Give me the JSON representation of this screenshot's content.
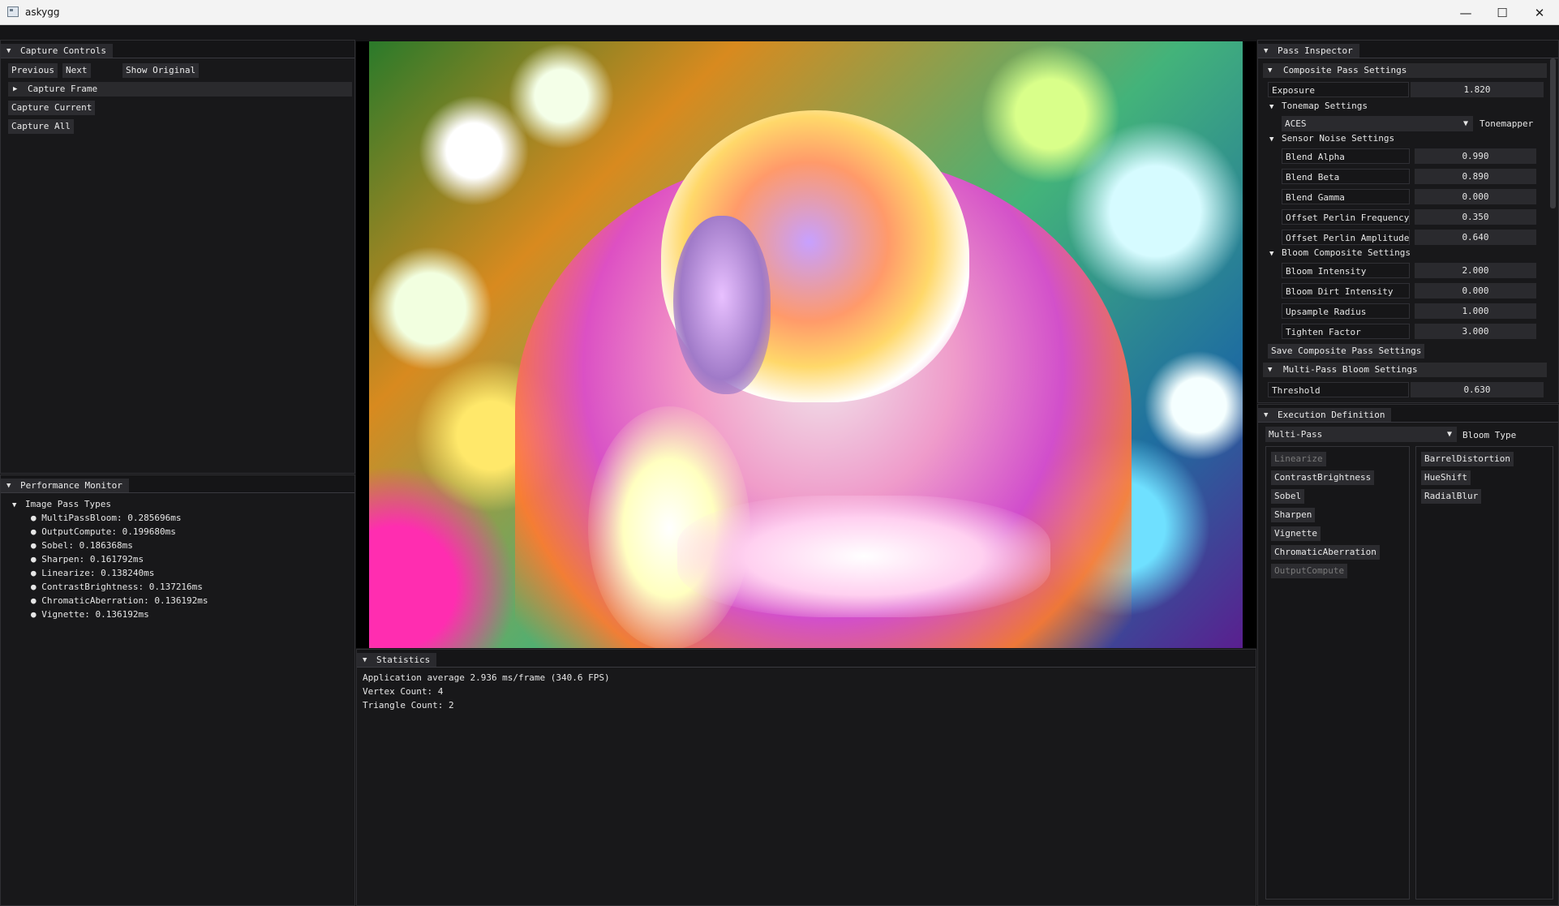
{
  "window": {
    "title": "askygg",
    "minimize": "—",
    "maximize": "☐",
    "close": "✕"
  },
  "capture_controls": {
    "title": "Capture Controls",
    "previous": "Previous",
    "next": "Next",
    "show_original": "Show Original",
    "capture_frame": "Capture Frame",
    "capture_current": "Capture Current",
    "capture_all": "Capture All"
  },
  "performance_monitor": {
    "title": "Performance Monitor",
    "group": "Image Pass Types",
    "items": [
      "MultiPassBloom: 0.285696ms",
      "OutputCompute: 0.199680ms",
      "Sobel: 0.186368ms",
      "Sharpen: 0.161792ms",
      "Linearize: 0.138240ms",
      "ContrastBrightness: 0.137216ms",
      "ChromaticAberration: 0.136192ms",
      "Vignette: 0.136192ms"
    ]
  },
  "statistics": {
    "title": "Statistics",
    "lines": [
      "Application average 2.936 ms/frame (340.6 FPS)",
      "Vertex Count: 4",
      "Triangle Count: 2"
    ]
  },
  "pass_inspector": {
    "title": "Pass Inspector",
    "composite_header": "Composite Pass Settings",
    "exposure_label": "Exposure",
    "exposure_value": "1.820",
    "tonemap_header": "Tonemap Settings",
    "tonemapper_value": "ACES",
    "tonemapper_label": "Tonemapper",
    "sensor_header": "Sensor Noise Settings",
    "sensor_fields": [
      {
        "label": "Blend Alpha",
        "value": "0.990"
      },
      {
        "label": "Blend Beta",
        "value": "0.890"
      },
      {
        "label": "Blend Gamma",
        "value": "0.000"
      },
      {
        "label": "Offset Perlin Frequency",
        "value": "0.350"
      },
      {
        "label": "Offset Perlin Amplitude",
        "value": "0.640"
      }
    ],
    "bloom_header": "Bloom Composite Settings",
    "bloom_fields": [
      {
        "label": "Bloom Intensity",
        "value": "2.000"
      },
      {
        "label": "Bloom Dirt Intensity",
        "value": "0.000"
      },
      {
        "label": "Upsample Radius",
        "value": "1.000"
      },
      {
        "label": "Tighten Factor",
        "value": "3.000"
      }
    ],
    "save_button": "Save Composite Pass Settings",
    "multipass_header": "Multi-Pass Bloom Settings",
    "threshold_label": "Threshold",
    "threshold_value": "0.630"
  },
  "execution_definition": {
    "title": "Execution Definition",
    "bloom_type_value": "Multi-Pass",
    "bloom_type_label": "Bloom Type",
    "left_list": [
      {
        "label": "Linearize",
        "enabled": false
      },
      {
        "label": "ContrastBrightness",
        "enabled": true
      },
      {
        "label": "Sobel",
        "enabled": true
      },
      {
        "label": "Sharpen",
        "enabled": true
      },
      {
        "label": "Vignette",
        "enabled": true
      },
      {
        "label": "ChromaticAberration",
        "enabled": true
      },
      {
        "label": "OutputCompute",
        "enabled": false
      }
    ],
    "right_list": [
      {
        "label": "BarrelDistortion",
        "enabled": true
      },
      {
        "label": "HueShift",
        "enabled": true
      },
      {
        "label": "RadialBlur",
        "enabled": true
      }
    ]
  }
}
